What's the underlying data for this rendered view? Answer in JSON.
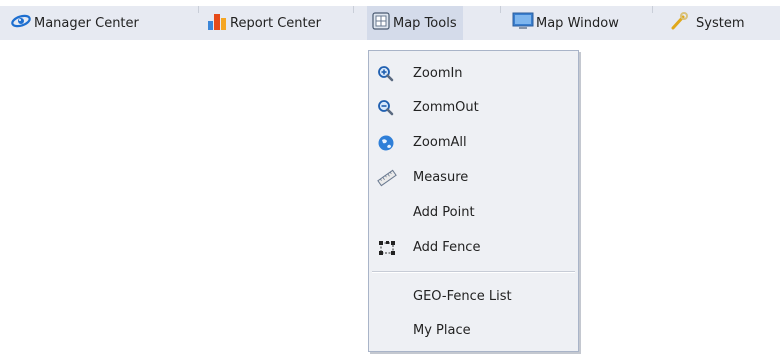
{
  "menubar": {
    "items": [
      {
        "label": "Manager Center",
        "icon": "eye-icon"
      },
      {
        "label": "Report Center",
        "icon": "bar-chart-icon"
      },
      {
        "label": "Map Tools",
        "icon": "map-tools-icon"
      },
      {
        "label": "Map Window",
        "icon": "monitor-icon"
      },
      {
        "label": "System",
        "icon": "wrench-icon"
      }
    ]
  },
  "dropdown": {
    "items": [
      {
        "label": "ZoomIn",
        "icon": "zoom-in-icon"
      },
      {
        "label": "ZommOut",
        "icon": "zoom-out-icon"
      },
      {
        "label": "ZoomAll",
        "icon": "globe-icon"
      },
      {
        "label": "Measure",
        "icon": "ruler-icon"
      },
      {
        "label": "Add Point",
        "icon": ""
      },
      {
        "label": "Add Fence",
        "icon": "fence-icon"
      },
      {
        "label": "GEO-Fence List",
        "icon": ""
      },
      {
        "label": "My Place",
        "icon": ""
      }
    ]
  }
}
